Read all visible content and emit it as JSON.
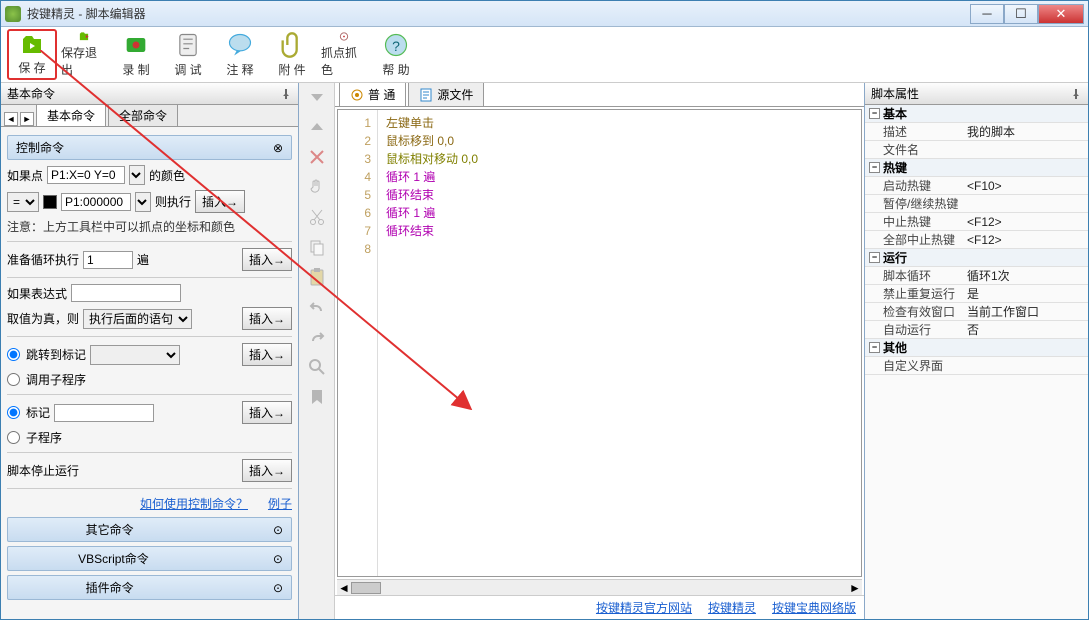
{
  "title": "按键精灵 - 脚本编辑器",
  "toolbar": [
    {
      "id": "save",
      "label": "保 存",
      "color": "#6b0"
    },
    {
      "id": "save-exit",
      "label": "保存退出",
      "color": "#6b0"
    },
    {
      "id": "record",
      "label": "录 制",
      "color": "#3a3"
    },
    {
      "id": "debug",
      "label": "调 试",
      "color": "#888"
    },
    {
      "id": "comment",
      "label": "注 释",
      "color": "#4ad"
    },
    {
      "id": "attach",
      "label": "附 件",
      "color": "#aa3"
    },
    {
      "id": "capture",
      "label": "抓点抓色",
      "color": "#a66"
    },
    {
      "id": "help",
      "label": "帮 助",
      "color": "#5b5"
    }
  ],
  "left": {
    "panel_title": "基本命令",
    "tabs": [
      "基本命令",
      "全部命令"
    ],
    "group_control": "控制命令",
    "if_point": "如果点",
    "p1_coord": "P1:X=0 Y=0",
    "color_of": "的颜色",
    "eq": "=",
    "p1_color": "P1:000000",
    "then_exec": "则执行",
    "insert": "插入→",
    "note_toolbar": "注意：上方工具栏中可以抓点的坐标和颜色",
    "loop_prepare": "准备循环执行",
    "loop_count": "1",
    "loop_unit": "遍",
    "if_expr": "如果表达式",
    "val_true": "取值为真，则",
    "exec_after": "执行后面的语句",
    "jump_mark": "跳转到标记",
    "call_sub": "调用子程序",
    "mark": "标记",
    "subprog": "子程序",
    "stop_script": "脚本停止运行",
    "howto": "如何使用控制命令？",
    "example": "例子",
    "other_cmd": "其它命令",
    "vbs_cmd": "VBScript命令",
    "plugin_cmd": "插件命令"
  },
  "center": {
    "tab_normal": "普 通",
    "tab_source": "源文件",
    "lines": [
      {
        "n": 1,
        "t": "左键单击",
        "c": "c-brown"
      },
      {
        "n": 2,
        "t": "鼠标移到 0,0",
        "c": "c-brown"
      },
      {
        "n": 3,
        "t": "鼠标相对移动 0,0",
        "c": "c-olive"
      },
      {
        "n": 4,
        "t": "循环 1 遍",
        "c": "c-purple"
      },
      {
        "n": 5,
        "t": "循环结束",
        "c": "c-purple"
      },
      {
        "n": 6,
        "t": "循环 1 遍",
        "c": "c-purple"
      },
      {
        "n": 7,
        "t": "循环结束",
        "c": "c-purple"
      },
      {
        "n": 8,
        "t": "",
        "c": ""
      }
    ]
  },
  "footer": {
    "link1": "按键精灵官方网站",
    "link2": "按键精灵",
    "link3": "按键宝典网络版"
  },
  "right": {
    "title": "脚本属性",
    "cats": {
      "basic": "基本",
      "hotkey": "热键",
      "run": "运行",
      "other": "其他"
    },
    "rows": {
      "desc_k": "描述",
      "desc_v": "我的脚本",
      "file_k": "文件名",
      "file_v": "",
      "start_k": "启动热键",
      "start_v": "<F10>",
      "pause_k": "暂停/继续热键",
      "pause_v": "",
      "stop_k": "中止热键",
      "stop_v": "<F12>",
      "stopall_k": "全部中止热键",
      "stopall_v": "<F12>",
      "loop_k": "脚本循环",
      "loop_v": "循环1次",
      "norepeat_k": "禁止重复运行",
      "norepeat_v": "是",
      "chkwin_k": "检查有效窗口",
      "chkwin_v": "当前工作窗口",
      "autorun_k": "自动运行",
      "autorun_v": "否",
      "custom_k": "自定义界面",
      "custom_v": ""
    }
  }
}
